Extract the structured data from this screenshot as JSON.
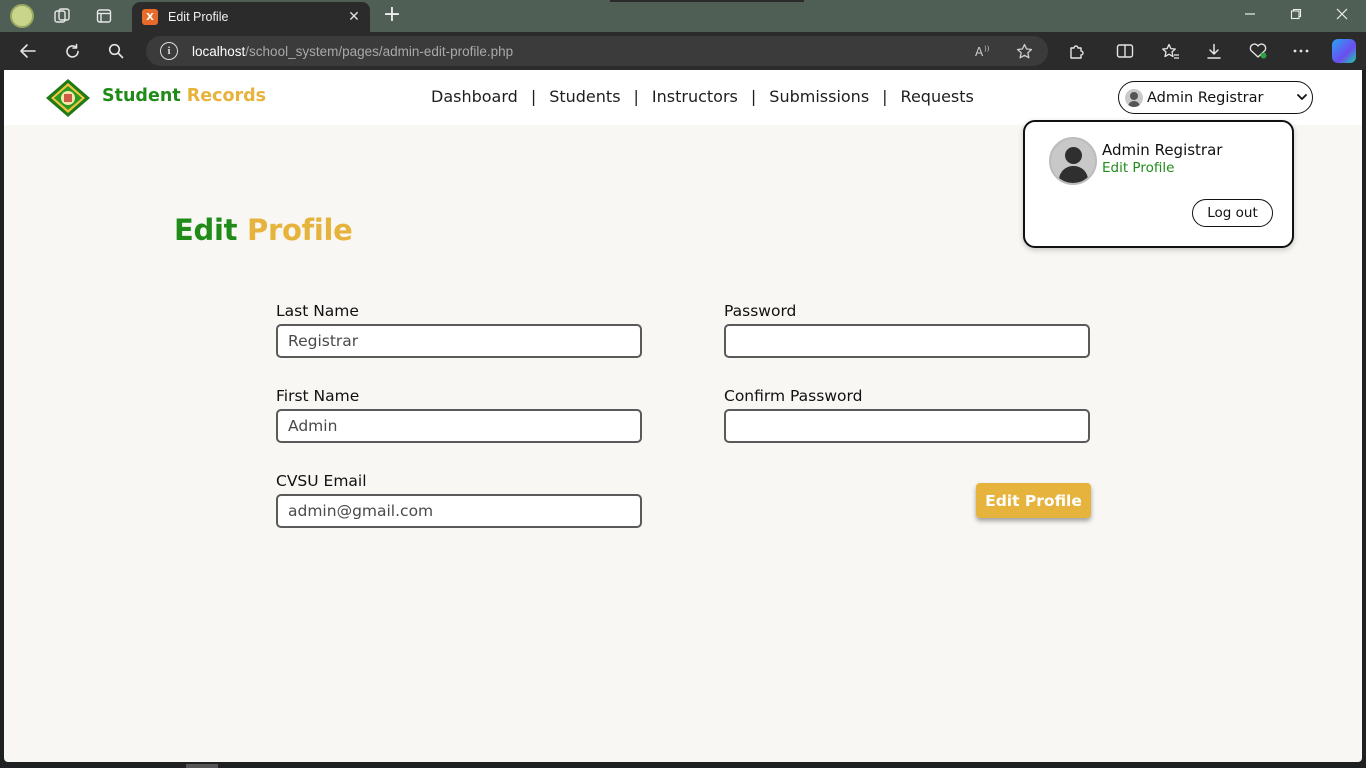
{
  "browser": {
    "tab_title": "Edit Profile",
    "tab_favicon_label": "X",
    "tab_close_glyph": "✕",
    "new_tab_glyph": "+",
    "url_host": "localhost",
    "url_path": "/school_system/pages/admin-edit-profile.php",
    "icons": [
      "profile-icon",
      "workspaces-icon",
      "tab-actions-icon",
      "back-icon",
      "refresh-icon",
      "search-icon",
      "site-info-icon",
      "read-aloud-icon",
      "favorite-icon",
      "extensions-icon",
      "split-screen-icon",
      "favorites-icon",
      "downloads-icon",
      "browser-essentials-icon",
      "more-icon",
      "copilot-icon",
      "minimize-icon",
      "restore-icon",
      "close-window-icon"
    ]
  },
  "nav": {
    "brand_part1": "Student",
    "brand_part2": "Records",
    "menu": [
      {
        "label": "Dashboard"
      },
      {
        "label": "Students"
      },
      {
        "label": "Instructors"
      },
      {
        "label": "Submissions"
      },
      {
        "label": "Requests"
      }
    ],
    "separator": "|",
    "user_select": "Admin Registrar"
  },
  "dropdown": {
    "name": "Admin Registrar",
    "edit_link": "Edit Profile",
    "logout": "Log out"
  },
  "page": {
    "title_part1": "Edit",
    "title_part2": "Profile"
  },
  "form": {
    "last_name": {
      "label": "Last Name",
      "placeholder": "Registrar"
    },
    "first_name": {
      "label": "First Name",
      "placeholder": "Admin"
    },
    "email": {
      "label": "CVSU Email",
      "placeholder": "admin@gmail.com"
    },
    "password": {
      "label": "Password",
      "placeholder": ""
    },
    "confirm_password": {
      "label": "Confirm Password",
      "placeholder": ""
    },
    "submit_label": "Edit Profile"
  },
  "colors": {
    "brand_green": "#218b1a",
    "brand_yellow": "#e6b33d",
    "page_bg": "#f8f7f4",
    "tabstrip_bg": "#4f5f56"
  }
}
